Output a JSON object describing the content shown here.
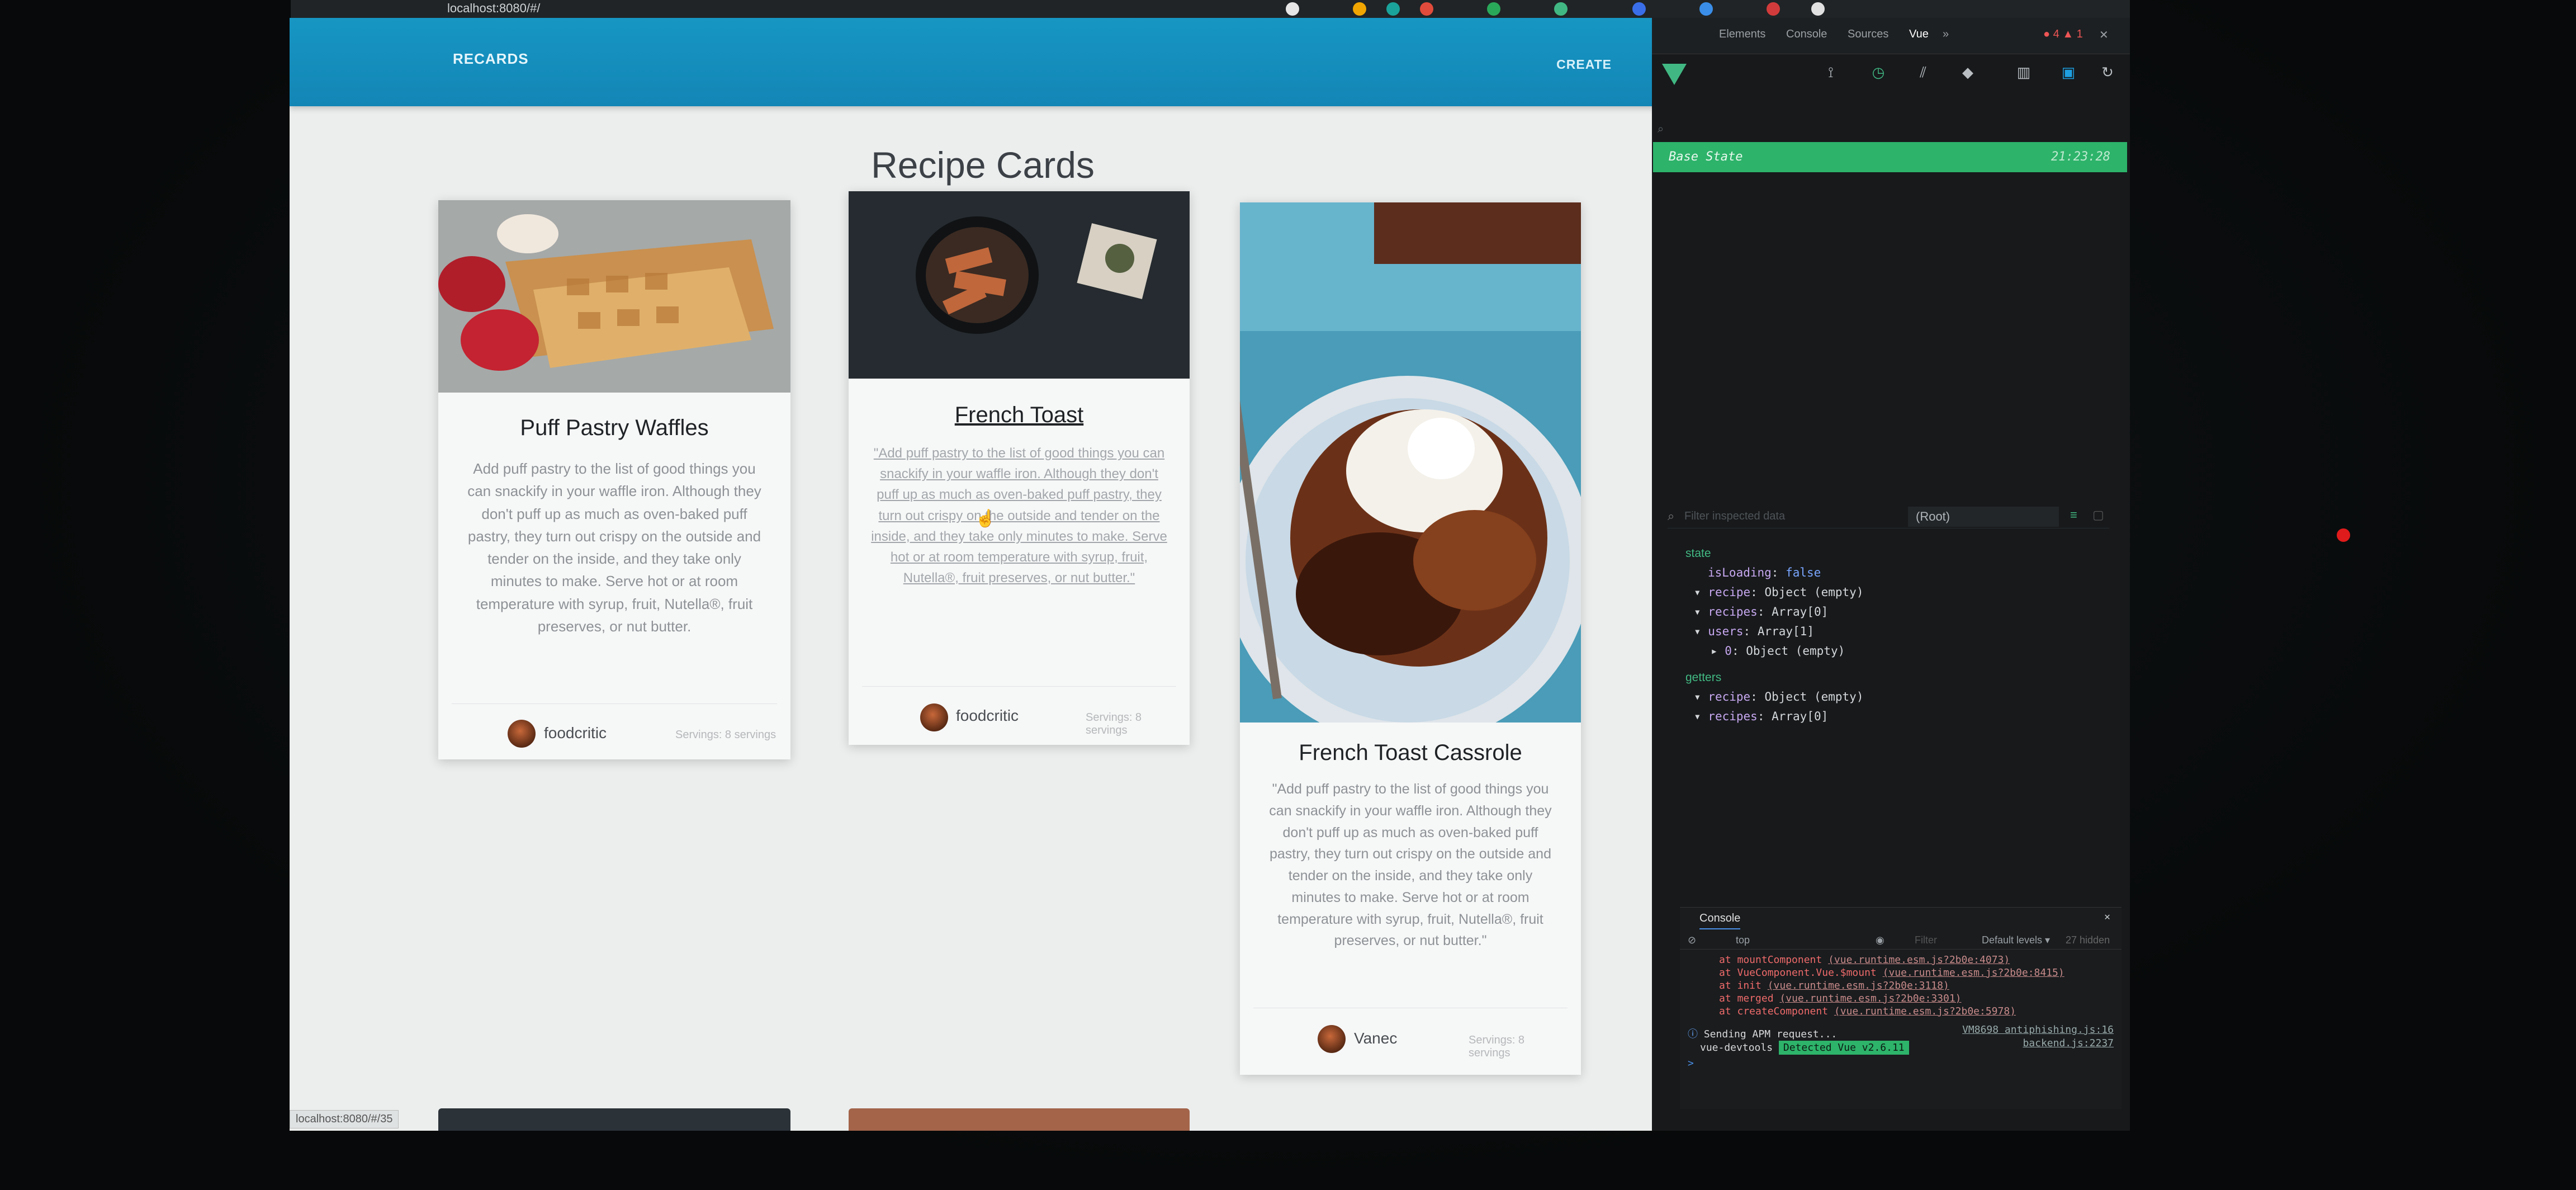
{
  "browser": {
    "url": "localhost:8080/#/",
    "status_url": "localhost:8080/#/35"
  },
  "app": {
    "brand": "RECARDS",
    "create_label": "CREATE",
    "page_title": "Recipe Cards"
  },
  "cards": [
    {
      "title": "Puff Pastry Waffles",
      "body": "Add puff pastry to the list of good things you can snackify in your waffle iron. Although they don't puff up as much as oven-baked puff pastry, they turn out crispy on the outside and tender on the inside, and they take only minutes to make. Serve hot or at room temperature with syrup, fruit, Nutella®, fruit preserves, or nut butter.",
      "author": "foodcritic",
      "servings": "Servings: 8 servings"
    },
    {
      "title": "French Toast",
      "body": "\"Add puff pastry to the list of good things you can snackify in your waffle iron. Although they don't puff up as much as oven-baked puff pastry, they turn out crispy on the outside and tender on the inside, and they take only minutes to make. Serve hot or at room temperature with syrup, fruit, Nutella®, fruit preserves, or nut butter.\"",
      "author": "foodcritic",
      "servings": "Servings: 8 servings"
    },
    {
      "title": "French Toast Cassrole",
      "body": "\"Add puff pastry to the list of good things you can snackify in your waffle iron. Although they don't puff up as much as oven-baked puff pastry, they turn out crispy on the outside and tender on the inside, and they take only minutes to make. Serve hot or at room temperature with syrup, fruit, Nutella®, fruit preserves, or nut butter.\"",
      "author": "Vanec",
      "servings": "Servings: 8 servings"
    }
  ],
  "devtools": {
    "tabs": [
      "Elements",
      "Console",
      "Sources",
      "Vue",
      "»"
    ],
    "base_state": "Base State",
    "base_time": "21:23:28",
    "root_select": "(Root)",
    "filter_placeholder": "Filter inspected data",
    "tree": {
      "state_label": "state",
      "isLoading_key": "isLoading",
      "isLoading_val": "false",
      "recipe_key": "recipe",
      "recipe_val": "Object (empty)",
      "recipes_key": "recipes",
      "recipes_val": "Array[0]",
      "users_key": "users",
      "users_val": "Array[1]",
      "user0_key": "0",
      "user0_val": "Object (empty)",
      "getters_label": "getters",
      "g_recipe_key": "recipe",
      "g_recipe_val": "Object (empty)",
      "g_recipes_key": "recipes",
      "g_recipes_val": "Array[0]"
    },
    "console": {
      "title": "Console",
      "context": "top",
      "filter": "Filter",
      "levels": "Default levels ▾",
      "hidden": "27 hidden",
      "errors": [
        {
          "text": "at mountComponent",
          "link": "(vue.runtime.esm.js?2b0e:4073)"
        },
        {
          "text": "at VueComponent.Vue.$mount",
          "link": "(vue.runtime.esm.js?2b0e:8415)"
        },
        {
          "text": "at init",
          "link": "(vue.runtime.esm.js?2b0e:3118)"
        },
        {
          "text": "at merged",
          "link": "(vue.runtime.esm.js?2b0e:3301)"
        },
        {
          "text": "at createComponent",
          "link": "(vue.runtime.esm.js?2b0e:5978)"
        }
      ],
      "sending": "Sending APM request...",
      "sending_src": "VM8698 antiphishing.js:16",
      "devtools_label": "vue-devtools",
      "detected": "Detected Vue v2.6.11",
      "backend_src": "backend.js:2237",
      "prompt": ">"
    }
  },
  "colors": {
    "appbar": "#1796c3",
    "vue_green": "#41b883",
    "base_state_bg": "#2db36a",
    "error_red": "#f06b6b"
  }
}
